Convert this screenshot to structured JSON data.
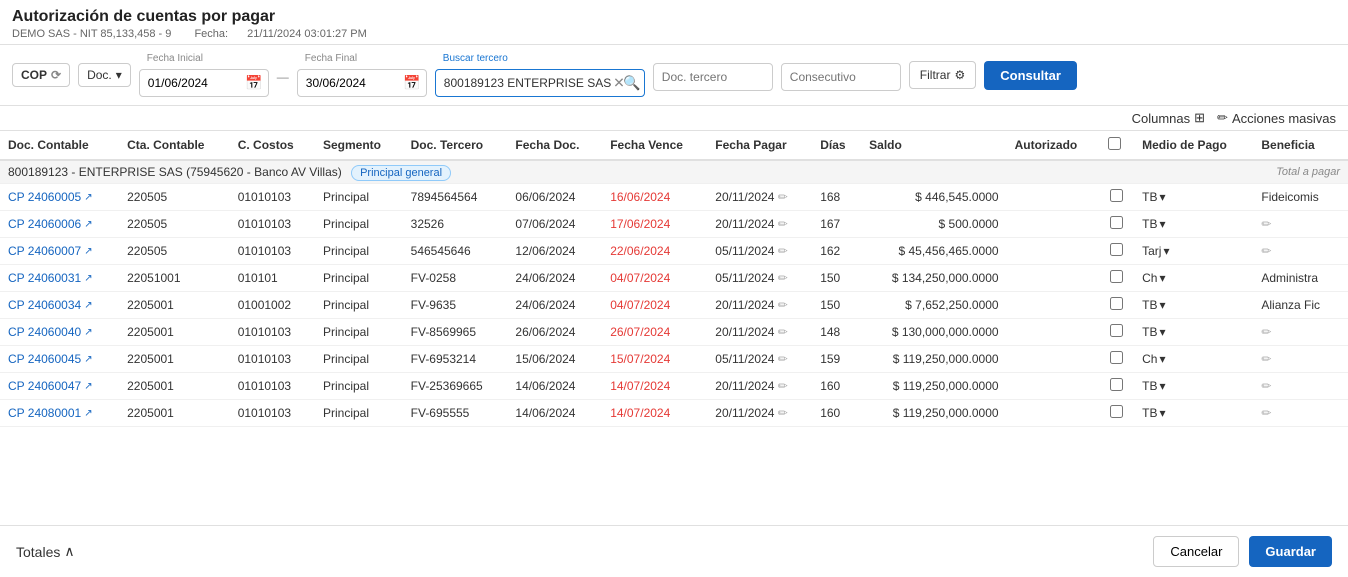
{
  "page": {
    "title": "Autorización de cuentas por pagar",
    "company": "DEMO SAS - NIT 85,133,458 - 9",
    "date_label": "Fecha:",
    "date_value": "21/11/2024 03:01:27 PM"
  },
  "toolbar": {
    "currency": "COP",
    "doc_label": "Doc.",
    "fecha_inicial_label": "Fecha Inicial",
    "fecha_inicial_value": "01/06/2024",
    "fecha_final_label": "Fecha Final",
    "fecha_final_value": "30/06/2024",
    "buscar_tercero_label": "Buscar tercero",
    "buscar_tercero_value": "800189123 ENTERPRISE SAS",
    "doc_tercero_placeholder": "Doc. tercero",
    "consecutivo_placeholder": "Consecutivo",
    "filtrar_label": "Filtrar",
    "consultar_label": "Consultar",
    "columnas_label": "Columnas",
    "acciones_masivas_label": "Acciones masivas"
  },
  "table": {
    "columns": [
      "Doc. Contable",
      "Cta. Contable",
      "C. Costos",
      "Segmento",
      "Doc. Tercero",
      "Fecha Doc.",
      "Fecha Vence",
      "Fecha Pagar",
      "Días",
      "Saldo",
      "Autorizado",
      "",
      "Medio de Pago",
      "Beneficia"
    ],
    "group": {
      "label": "800189123 - ENTERPRISE SAS (75945620 - Banco AV Villas)",
      "badge": "Principal general",
      "total_label": "Total a pagar"
    },
    "rows": [
      {
        "doc_contable": "CP 24060005",
        "cta_contable": "220505",
        "c_costos": "01010103",
        "segmento": "Principal",
        "doc_tercero": "7894564564",
        "fecha_doc": "06/06/2024",
        "fecha_vence": "16/06/2024",
        "fecha_vence_red": true,
        "fecha_pagar": "20/11/2024",
        "dias": "168",
        "saldo": "$ 446,545.0000",
        "medio": "TB",
        "beneficia": "Fideicomis"
      },
      {
        "doc_contable": "CP 24060006",
        "cta_contable": "220505",
        "c_costos": "01010103",
        "segmento": "Principal",
        "doc_tercero": "32526",
        "fecha_doc": "07/06/2024",
        "fecha_vence": "17/06/2024",
        "fecha_vence_red": true,
        "fecha_pagar": "20/11/2024",
        "dias": "167",
        "saldo": "$ 500.0000",
        "medio": "TB",
        "beneficia": ""
      },
      {
        "doc_contable": "CP 24060007",
        "cta_contable": "220505",
        "c_costos": "01010103",
        "segmento": "Principal",
        "doc_tercero": "546545646",
        "fecha_doc": "12/06/2024",
        "fecha_vence": "22/06/2024",
        "fecha_vence_red": true,
        "fecha_pagar": "05/11/2024",
        "dias": "162",
        "saldo": "$ 45,456,465.0000",
        "medio": "Tarj",
        "beneficia": ""
      },
      {
        "doc_contable": "CP 24060031",
        "cta_contable": "22051001",
        "c_costos": "010101",
        "segmento": "Principal",
        "doc_tercero": "FV-0258",
        "fecha_doc": "24/06/2024",
        "fecha_vence": "04/07/2024",
        "fecha_vence_red": true,
        "fecha_pagar": "05/11/2024",
        "dias": "150",
        "saldo": "$ 134,250,000.0000",
        "medio": "Ch",
        "beneficia": "Administra"
      },
      {
        "doc_contable": "CP 24060034",
        "cta_contable": "2205001",
        "c_costos": "01001002",
        "segmento": "Principal",
        "doc_tercero": "FV-9635",
        "fecha_doc": "24/06/2024",
        "fecha_vence": "04/07/2024",
        "fecha_vence_red": true,
        "fecha_pagar": "20/11/2024",
        "dias": "150",
        "saldo": "$ 7,652,250.0000",
        "medio": "TB",
        "beneficia": "Alianza Fic"
      },
      {
        "doc_contable": "CP 24060040",
        "cta_contable": "2205001",
        "c_costos": "01010103",
        "segmento": "Principal",
        "doc_tercero": "FV-8569965",
        "fecha_doc": "26/06/2024",
        "fecha_vence": "26/07/2024",
        "fecha_vence_red": true,
        "fecha_pagar": "20/11/2024",
        "dias": "148",
        "saldo": "$ 130,000,000.0000",
        "medio": "TB",
        "beneficia": ""
      },
      {
        "doc_contable": "CP 24060045",
        "cta_contable": "2205001",
        "c_costos": "01010103",
        "segmento": "Principal",
        "doc_tercero": "FV-6953214",
        "fecha_doc": "15/06/2024",
        "fecha_vence": "15/07/2024",
        "fecha_vence_red": true,
        "fecha_pagar": "05/11/2024",
        "dias": "159",
        "saldo": "$ 119,250,000.0000",
        "medio": "Ch",
        "beneficia": ""
      },
      {
        "doc_contable": "CP 24060047",
        "cta_contable": "2205001",
        "c_costos": "01010103",
        "segmento": "Principal",
        "doc_tercero": "FV-25369665",
        "fecha_doc": "14/06/2024",
        "fecha_vence": "14/07/2024",
        "fecha_vence_red": true,
        "fecha_pagar": "20/11/2024",
        "dias": "160",
        "saldo": "$ 119,250,000.0000",
        "medio": "TB",
        "beneficia": ""
      },
      {
        "doc_contable": "CP 24080001",
        "cta_contable": "2205001",
        "c_costos": "01010103",
        "segmento": "Principal",
        "doc_tercero": "FV-695555",
        "fecha_doc": "14/06/2024",
        "fecha_vence": "14/07/2024",
        "fecha_vence_red": true,
        "fecha_pagar": "20/11/2024",
        "dias": "160",
        "saldo": "$ 119,250,000.0000",
        "medio": "TB",
        "beneficia": ""
      }
    ]
  },
  "footer": {
    "totales_label": "Totales",
    "cancel_label": "Cancelar",
    "save_label": "Guardar"
  }
}
